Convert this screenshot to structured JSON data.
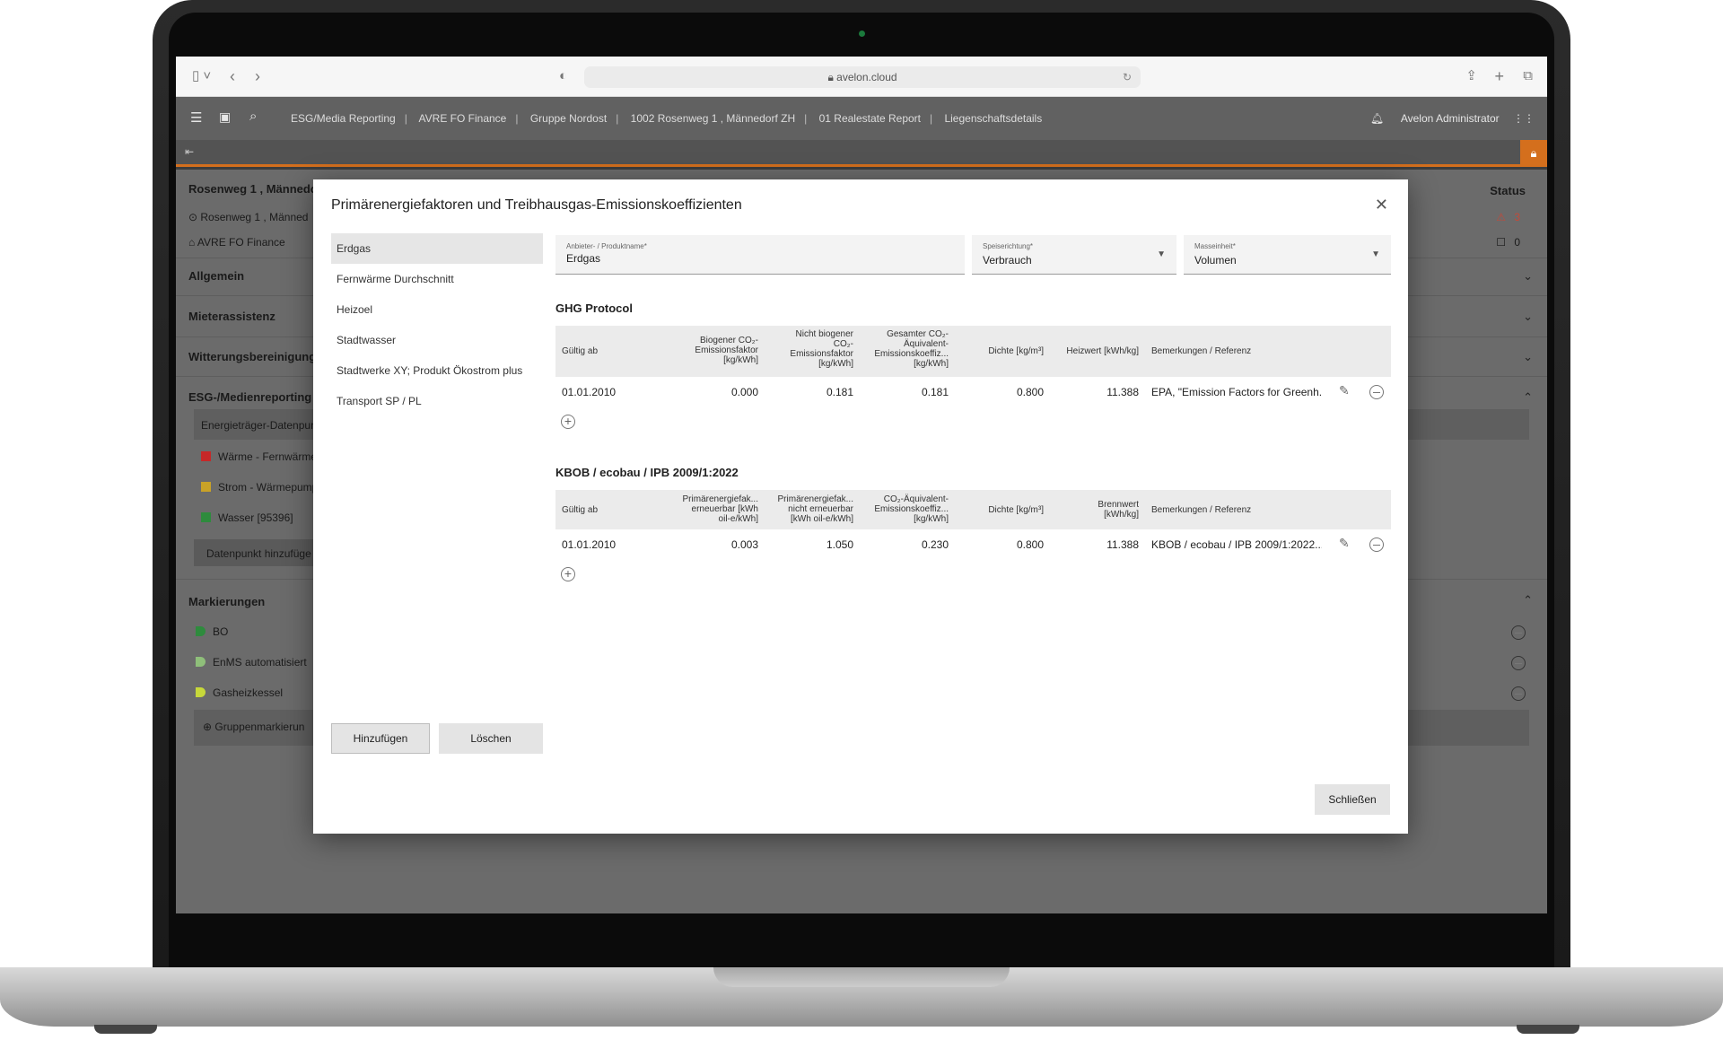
{
  "browser": {
    "url": "avelon.cloud"
  },
  "header": {
    "breadcrumbs": [
      "ESG/Media Reporting",
      "AVRE FO Finance",
      "Gruppe Nordost",
      "1002 Rosenweg 1 , Männedorf ZH",
      "01 Realestate Report",
      "Liegenschaftsdetails"
    ],
    "user": "Avelon Administrator"
  },
  "background": {
    "title": "Rosenweg 1 , Männedo",
    "address": "Rosenweg 1 , Männed",
    "org": "AVRE FO Finance",
    "status_label": "Status",
    "status_count_1": "3",
    "status_count_2": "0",
    "sections": [
      "Allgemein",
      "Mieterassistenz",
      "Witterungsbereinigung",
      "ESG-/Medienreporting"
    ],
    "datapoint_header": "Energieträger-Datenpun",
    "datapoints": [
      {
        "label": "Wärme - Fernwärme",
        "color": "#c62828"
      },
      {
        "label": "Strom - Wärmepump",
        "color": "#c9a227"
      },
      {
        "label": "Wasser [95396]",
        "color": "#2e8b3d"
      }
    ],
    "add_datapoint": "Datenpunkt hinzufüge",
    "markings_title": "Markierungen",
    "markings": [
      {
        "label": "BO",
        "color": "#2e8b3d"
      },
      {
        "label": "EnMS automatisiert",
        "color": "#8fbf7a"
      },
      {
        "label": "Gasheizkessel",
        "color": "#c7d83a"
      }
    ],
    "group_marking": "Gruppenmarkierun"
  },
  "modal": {
    "title": "Primärenergiefaktoren und Treibhausgas-Emissionskoeffizienten",
    "list": [
      "Erdgas",
      "Fernwärme Durchschnitt",
      "Heizoel",
      "Stadtwasser",
      "Stadtwerke XY; Produkt Ökostrom plus",
      "Transport SP / PL"
    ],
    "add_label": "Hinzufügen",
    "delete_label": "Löschen",
    "close_label": "Schließen",
    "fields": {
      "provider": {
        "label": "Anbieter- / Produktname*",
        "value": "Erdgas"
      },
      "direction": {
        "label": "Speiserichtung*",
        "value": "Verbrauch"
      },
      "unit": {
        "label": "Masseinheit*",
        "value": "Volumen"
      }
    },
    "ghg": {
      "title": "GHG Protocol",
      "headers": [
        "Gültig ab",
        "Biogener CO₂-\nEmissionsfaktor\n[kg/kWh]",
        "Nicht biogener\nCO₂-\nEmissionsfaktor\n[kg/kWh]",
        "Gesamter CO₂-\nÄquivalent-\nEmissionskoeffiz...\n[kg/kWh]",
        "Dichte [kg/m³]",
        "Heizwert [kWh/kg]",
        "Bemerkungen / Referenz"
      ],
      "row": [
        "01.01.2010",
        "0.000",
        "0.181",
        "0.181",
        "0.800",
        "11.388",
        "EPA, \"Emission Factors for Greenh..."
      ]
    },
    "kbob": {
      "title": "KBOB / ecobau / IPB 2009/1:2022",
      "headers": [
        "Gültig ab",
        "Primärenergiefak...\nerneuerbar [kWh\noil-e/kWh]",
        "Primärenergiefak...\nnicht erneuerbar\n[kWh oil-e/kWh]",
        "CO₂-Äquivalent-\nEmissionskoeffiz...\n[kg/kWh]",
        "Dichte [kg/m³]",
        "Brennwert\n[kWh/kg]",
        "Bemerkungen / Referenz"
      ],
      "row": [
        "01.01.2010",
        "0.003",
        "1.050",
        "0.230",
        "0.800",
        "11.388",
        "KBOB / ecobau / IPB 2009/1:2022..."
      ]
    }
  }
}
